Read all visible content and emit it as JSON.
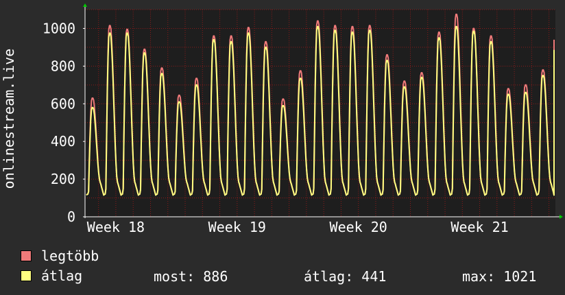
{
  "chart_data": {
    "type": "line",
    "ylabel": "onlinestream.live",
    "ylim": [
      0,
      1100
    ],
    "y_ticks": [
      0,
      200,
      400,
      600,
      800,
      1000
    ],
    "x_tick_labels": [
      "Week 18",
      "Week 19",
      "Week 20",
      "Week 21"
    ],
    "grid": true,
    "legend_placement": "bottom-left",
    "series": [
      {
        "name": "legtöbb",
        "color": "#f07a7a",
        "daily_peaks": [
          630,
          1015,
          995,
          890,
          790,
          645,
          735,
          960,
          960,
          1005,
          930,
          625,
          775,
          1040,
          1015,
          1010,
          1015,
          860,
          720,
          765,
          980,
          1075,
          1000,
          960,
          680,
          700,
          780
        ],
        "last_value": 940
      },
      {
        "name": "átlag",
        "color": "#ffff80",
        "daily_peaks": [
          580,
          975,
          975,
          870,
          760,
          610,
          700,
          940,
          930,
          975,
          900,
          590,
          735,
          1010,
          990,
          980,
          990,
          830,
          690,
          740,
          950,
          1010,
          985,
          930,
          650,
          660,
          750
        ],
        "last_value": 886
      }
    ],
    "daily_trough": 115
  },
  "legend": {
    "items": [
      {
        "label": "legtöbb",
        "color": "#f07a7a"
      },
      {
        "label": "átlag",
        "color": "#ffff80"
      }
    ]
  },
  "stats": {
    "now": "most: 886",
    "avg": "átlag: 441",
    "max": "max: 1021"
  },
  "colors": {
    "background": "#2b2b2b",
    "plot_background": "#1e1e1e",
    "grid": "#8b1a1a",
    "axis": "#ffffff",
    "arrow": "#00cc00"
  }
}
